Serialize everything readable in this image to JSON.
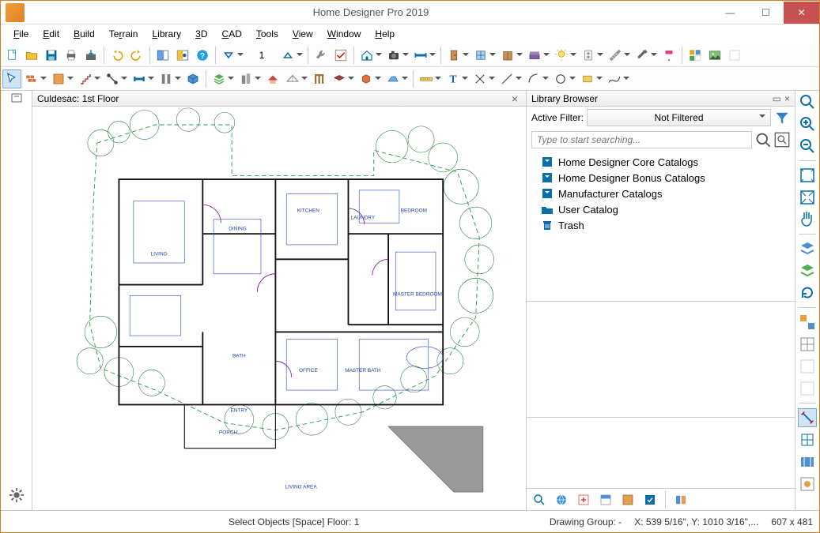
{
  "app": {
    "title": "Home Designer Pro 2019"
  },
  "menu": {
    "items": [
      "File",
      "Edit",
      "Build",
      "Terrain",
      "Library",
      "3D",
      "CAD",
      "Tools",
      "View",
      "Window",
      "Help"
    ]
  },
  "toolbar1_spin_value": "1",
  "canvas": {
    "tab_label": "Culdesac:  1st Floor",
    "rooms": [
      "LIVING",
      "DINING",
      "KITCHEN",
      "LAUNDRY",
      "BEDROOM",
      "OFFICE",
      "MASTER BATH",
      "MASTER BEDROOM",
      "PORCH",
      "BATH",
      "ENTRY"
    ]
  },
  "library": {
    "title": "Library Browser",
    "filter_label": "Active Filter:",
    "filter_value": "Not Filtered",
    "search_placeholder": "Type to start searching...",
    "tree": [
      {
        "icon": "catalog",
        "label": "Home Designer Core Catalogs"
      },
      {
        "icon": "catalog",
        "label": "Home Designer Bonus Catalogs"
      },
      {
        "icon": "catalog",
        "label": "Manufacturer Catalogs"
      },
      {
        "icon": "folder",
        "label": "User Catalog"
      },
      {
        "icon": "trash",
        "label": "Trash"
      }
    ]
  },
  "status": {
    "hint": "Select Objects [Space]  Floor: 1",
    "drawing_group": "Drawing Group: -",
    "coords": "X: 539 5/16\", Y: 1010 3/16\",...",
    "dims": "607 x 481"
  }
}
